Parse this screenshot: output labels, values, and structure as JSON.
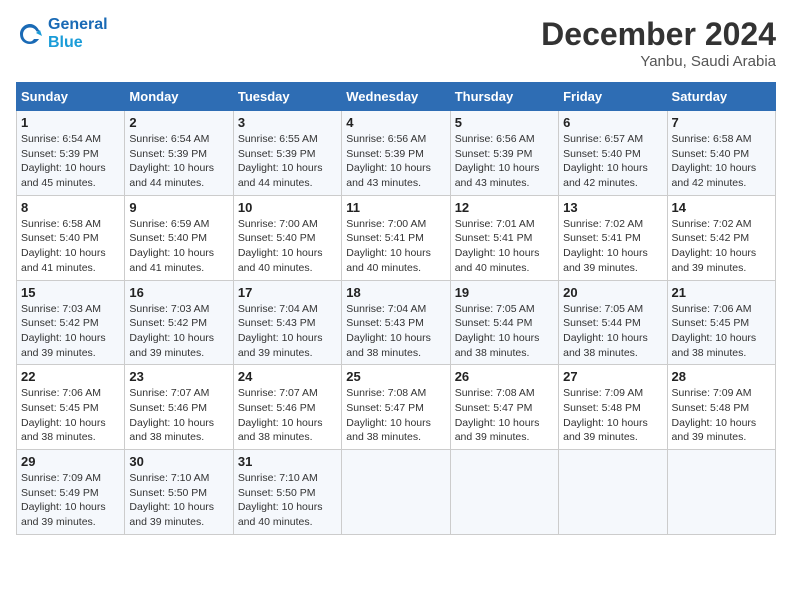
{
  "header": {
    "logo_line1": "General",
    "logo_line2": "Blue",
    "month": "December 2024",
    "location": "Yanbu, Saudi Arabia"
  },
  "weekdays": [
    "Sunday",
    "Monday",
    "Tuesday",
    "Wednesday",
    "Thursday",
    "Friday",
    "Saturday"
  ],
  "weeks": [
    [
      {
        "day": "1",
        "sunrise": "6:54 AM",
        "sunset": "5:39 PM",
        "daylight": "10 hours and 45 minutes."
      },
      {
        "day": "2",
        "sunrise": "6:54 AM",
        "sunset": "5:39 PM",
        "daylight": "10 hours and 44 minutes."
      },
      {
        "day": "3",
        "sunrise": "6:55 AM",
        "sunset": "5:39 PM",
        "daylight": "10 hours and 44 minutes."
      },
      {
        "day": "4",
        "sunrise": "6:56 AM",
        "sunset": "5:39 PM",
        "daylight": "10 hours and 43 minutes."
      },
      {
        "day": "5",
        "sunrise": "6:56 AM",
        "sunset": "5:39 PM",
        "daylight": "10 hours and 43 minutes."
      },
      {
        "day": "6",
        "sunrise": "6:57 AM",
        "sunset": "5:40 PM",
        "daylight": "10 hours and 42 minutes."
      },
      {
        "day": "7",
        "sunrise": "6:58 AM",
        "sunset": "5:40 PM",
        "daylight": "10 hours and 42 minutes."
      }
    ],
    [
      {
        "day": "8",
        "sunrise": "6:58 AM",
        "sunset": "5:40 PM",
        "daylight": "10 hours and 41 minutes."
      },
      {
        "day": "9",
        "sunrise": "6:59 AM",
        "sunset": "5:40 PM",
        "daylight": "10 hours and 41 minutes."
      },
      {
        "day": "10",
        "sunrise": "7:00 AM",
        "sunset": "5:40 PM",
        "daylight": "10 hours and 40 minutes."
      },
      {
        "day": "11",
        "sunrise": "7:00 AM",
        "sunset": "5:41 PM",
        "daylight": "10 hours and 40 minutes."
      },
      {
        "day": "12",
        "sunrise": "7:01 AM",
        "sunset": "5:41 PM",
        "daylight": "10 hours and 40 minutes."
      },
      {
        "day": "13",
        "sunrise": "7:02 AM",
        "sunset": "5:41 PM",
        "daylight": "10 hours and 39 minutes."
      },
      {
        "day": "14",
        "sunrise": "7:02 AM",
        "sunset": "5:42 PM",
        "daylight": "10 hours and 39 minutes."
      }
    ],
    [
      {
        "day": "15",
        "sunrise": "7:03 AM",
        "sunset": "5:42 PM",
        "daylight": "10 hours and 39 minutes."
      },
      {
        "day": "16",
        "sunrise": "7:03 AM",
        "sunset": "5:42 PM",
        "daylight": "10 hours and 39 minutes."
      },
      {
        "day": "17",
        "sunrise": "7:04 AM",
        "sunset": "5:43 PM",
        "daylight": "10 hours and 39 minutes."
      },
      {
        "day": "18",
        "sunrise": "7:04 AM",
        "sunset": "5:43 PM",
        "daylight": "10 hours and 38 minutes."
      },
      {
        "day": "19",
        "sunrise": "7:05 AM",
        "sunset": "5:44 PM",
        "daylight": "10 hours and 38 minutes."
      },
      {
        "day": "20",
        "sunrise": "7:05 AM",
        "sunset": "5:44 PM",
        "daylight": "10 hours and 38 minutes."
      },
      {
        "day": "21",
        "sunrise": "7:06 AM",
        "sunset": "5:45 PM",
        "daylight": "10 hours and 38 minutes."
      }
    ],
    [
      {
        "day": "22",
        "sunrise": "7:06 AM",
        "sunset": "5:45 PM",
        "daylight": "10 hours and 38 minutes."
      },
      {
        "day": "23",
        "sunrise": "7:07 AM",
        "sunset": "5:46 PM",
        "daylight": "10 hours and 38 minutes."
      },
      {
        "day": "24",
        "sunrise": "7:07 AM",
        "sunset": "5:46 PM",
        "daylight": "10 hours and 38 minutes."
      },
      {
        "day": "25",
        "sunrise": "7:08 AM",
        "sunset": "5:47 PM",
        "daylight": "10 hours and 38 minutes."
      },
      {
        "day": "26",
        "sunrise": "7:08 AM",
        "sunset": "5:47 PM",
        "daylight": "10 hours and 39 minutes."
      },
      {
        "day": "27",
        "sunrise": "7:09 AM",
        "sunset": "5:48 PM",
        "daylight": "10 hours and 39 minutes."
      },
      {
        "day": "28",
        "sunrise": "7:09 AM",
        "sunset": "5:48 PM",
        "daylight": "10 hours and 39 minutes."
      }
    ],
    [
      {
        "day": "29",
        "sunrise": "7:09 AM",
        "sunset": "5:49 PM",
        "daylight": "10 hours and 39 minutes."
      },
      {
        "day": "30",
        "sunrise": "7:10 AM",
        "sunset": "5:50 PM",
        "daylight": "10 hours and 39 minutes."
      },
      {
        "day": "31",
        "sunrise": "7:10 AM",
        "sunset": "5:50 PM",
        "daylight": "10 hours and 40 minutes."
      },
      null,
      null,
      null,
      null
    ]
  ]
}
